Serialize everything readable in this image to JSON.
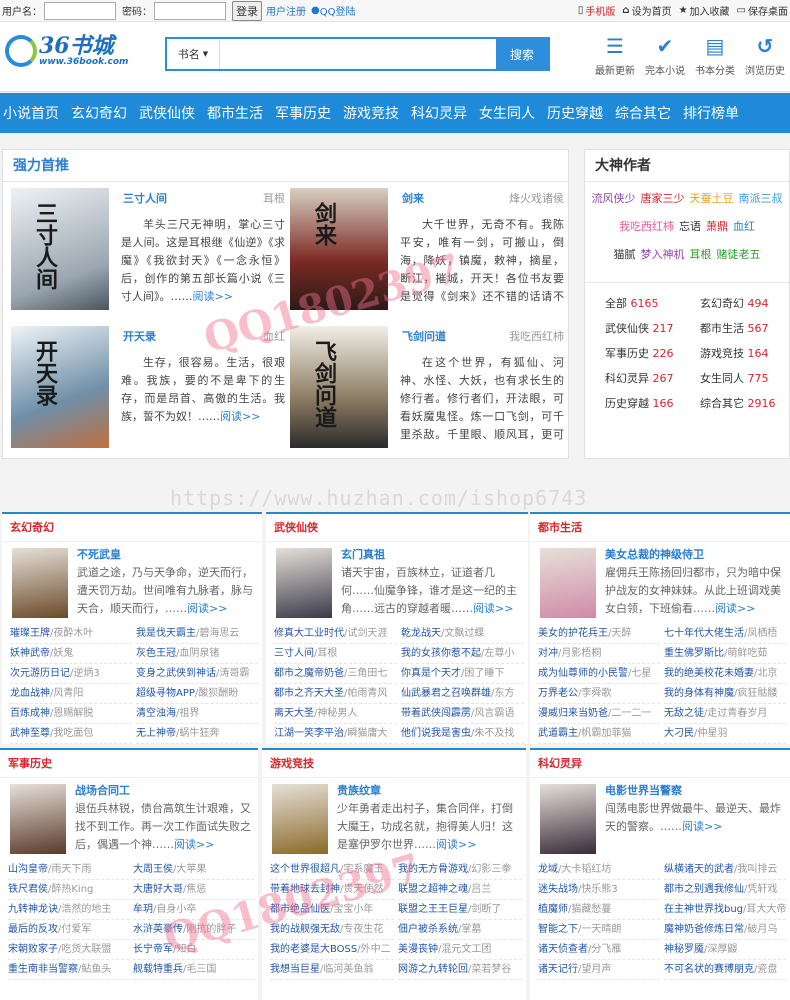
{
  "topbar": {
    "username_label": "用户名：",
    "password_label": "密码：",
    "login_btn": "登录",
    "register": "用户注册",
    "qq_login": "QQ登陆",
    "mobile": "手机版",
    "homepage": "设为首页",
    "favorite": "加入收藏",
    "save_desktop": "保存桌面"
  },
  "header": {
    "logo_name": "36书城",
    "logo_url": "www.36book.com",
    "search_select": "书名",
    "search_btn": "搜索",
    "icons": [
      {
        "label": "最新更新",
        "icon": "list-icon"
      },
      {
        "label": "完本小说",
        "icon": "check-circle-icon"
      },
      {
        "label": "书本分类",
        "icon": "book-icon"
      },
      {
        "label": "浏览历史",
        "icon": "history-icon"
      }
    ]
  },
  "nav": [
    "小说首页",
    "玄幻奇幻",
    "武侠仙侠",
    "都市生活",
    "军事历史",
    "游戏竞技",
    "科幻灵异",
    "女生同人",
    "历史穿越",
    "综合其它",
    "排行榜单"
  ],
  "featured": {
    "title": "强力首推",
    "books": [
      {
        "title": "三寸人间",
        "author": "耳根",
        "desc": "羊头三尺无神明，掌心三寸是人间。这是耳根继《仙逆》《求魔》《我欲封天》《一念永恒》后，创作的第五部长篇小说《三寸人间》。……",
        "more": "阅读>>"
      },
      {
        "title": "剑来",
        "author": "烽火戏诸侯",
        "desc": "大千世界，无奇不有。我陈平安，唯有一剑，可搬山，倒海，降妖，镇魔，敕神，摘星，断江，摧城，开天！各位书友要是觉得《剑来》还不错的话请不要……",
        "more": "阅读>>"
      },
      {
        "title": "开天录",
        "author": "血红",
        "desc": "生存，很容易。生活，很艰难。我族，要的不是卑下的生存，而是昂首、高傲的生活。我族，誓不为奴！……",
        "more": "阅读>>"
      },
      {
        "title": "飞剑问道",
        "author": "我吃西红柿",
        "desc": "在这个世界，有狐仙、河神、水怪、大妖，也有求长生的修行者。修行者们，开法眼，可看妖魔鬼怪。炼一口飞剑，可千里杀敌。千里眼、顺风耳，更可探查四……",
        "more": "阅读>>"
      }
    ]
  },
  "authors": {
    "title": "大神作者",
    "rows": [
      [
        "流风侠少",
        "唐家三少",
        "天蚕土豆",
        "南派三叔"
      ],
      [
        "我吃西红柿",
        "忘语",
        "萧鼎",
        "血红"
      ],
      [
        "猫腻",
        "梦入神机",
        "耳根",
        "赌徒老五"
      ]
    ],
    "colors": [
      [
        "#8e44ad",
        "#d9242b",
        "#e8a317",
        "#3a9ad9"
      ],
      [
        "#e95aa0",
        "#333333",
        "#d9242b",
        "#2a7fd2"
      ],
      [
        "#333333",
        "#8e44ad",
        "#2a9d2a",
        "#2a9d2a"
      ]
    ]
  },
  "categories": [
    {
      "name": "全部",
      "count": "6165"
    },
    {
      "name": "玄幻奇幻",
      "count": "494"
    },
    {
      "name": "武侠仙侠",
      "count": "217"
    },
    {
      "name": "都市生活",
      "count": "567"
    },
    {
      "name": "军事历史",
      "count": "226"
    },
    {
      "name": "游戏竞技",
      "count": "164"
    },
    {
      "name": "科幻灵异",
      "count": "267"
    },
    {
      "name": "女生同人",
      "count": "775"
    },
    {
      "name": "历史穿越",
      "count": "166"
    },
    {
      "name": "综合其它",
      "count": "2916"
    }
  ],
  "watermark": {
    "url": "https://www.huzhan.com/ishop6743",
    "qq": "QQ1802397"
  },
  "sections": [
    {
      "title": "玄幻奇幻",
      "book": {
        "title": "不死武皇",
        "desc": "武道之途，乃与天争命，逆天而行，遭天罚万劫。世间唯有九脉者，脉与天合，顺天而行，……",
        "more": "阅读>>"
      },
      "links": [
        [
          "璀璨王牌",
          "/夜酔木叶"
        ],
        [
          "我是伐天霸主",
          "/碧海思云"
        ],
        [
          "妖神武帝",
          "/妖鬼"
        ],
        [
          "灰色王冠",
          "/血阴泉锗"
        ],
        [
          "次元游历日记",
          "/逆炳3"
        ],
        [
          "变身之武侠到神话",
          "/涛哥霸"
        ],
        [
          "龙血战神",
          "/风青阳"
        ],
        [
          "超级寻物APP",
          "/酸狈酬盼"
        ],
        [
          "百炼成神",
          "/恩赐解脱"
        ],
        [
          "清空浊海",
          "/祖界"
        ],
        [
          "武神至尊",
          "/我吃面包"
        ],
        [
          "无上神帝",
          "/蜗牛狂奔"
        ]
      ]
    },
    {
      "title": "武侠仙侠",
      "book": {
        "title": "玄门真祖",
        "desc": "诸天宇宙，百族林立，证道者几何……仙魔争锋，谁才是这一纪的主角……远古的穿越者暖……",
        "more": "阅读>>"
      },
      "links": [
        [
          "修真大工业时代",
          "/试剑天涯"
        ],
        [
          "乾龙战天",
          "/文飘过蝶"
        ],
        [
          "三寸人间",
          "/耳根"
        ],
        [
          "我的女孩你惹不起",
          "/左尊小"
        ],
        [
          "都市之魔帝奶爸",
          "/三角田七"
        ],
        [
          "你真是个天才",
          "/困了睡下"
        ],
        [
          "都市之齐天大圣",
          "/帕雨青风"
        ],
        [
          "仙武暴君之召唤群雄",
          "/东方"
        ],
        [
          "离天大圣",
          "/神秘男人"
        ],
        [
          "带着武侠闯霹雳",
          "/风言霸语"
        ],
        [
          "江湖一笑李平治",
          "/瞬猫庸大"
        ],
        [
          "他们说我是害虫",
          "/朱不及找"
        ]
      ]
    },
    {
      "title": "都市生活",
      "book": {
        "title": "美女总裁的神级侍卫",
        "desc": "雇佣兵王陈扬回归都市，只为暗中保护战友的女神妹妹。从此上班调戏美女白领，下班偷看……",
        "more": "阅读>>"
      },
      "links": [
        [
          "美女的护花兵王",
          "/天醉"
        ],
        [
          "七十年代大佬生活",
          "/凤栖梧"
        ],
        [
          "对冲",
          "/月影梧桐"
        ],
        [
          "重生佛罗斯比",
          "/萌鲜吃茹"
        ],
        [
          "成为仙尊师的小民警",
          "/七星"
        ],
        [
          "我的绝美校花未婚妻",
          "/北京"
        ],
        [
          "万界老公",
          "/李舜歌"
        ],
        [
          "我的身体有神魔",
          "/疯狂骷髅"
        ],
        [
          "漫威归来当奶爸",
          "/二一二一"
        ],
        [
          "无敌之徒",
          "/走过青春岁月"
        ],
        [
          "武道霸主",
          "/帆霸加菲猫"
        ],
        [
          "大刁民",
          "/仲星羽"
        ]
      ]
    },
    {
      "title": "军事历史",
      "book": {
        "title": "战场合同工",
        "desc": "退伍兵林锐，债台高筑生计艰难，又找不到工作。再一次工作面试失败之后，偶遇一个神……",
        "more": "阅读>>"
      },
      "links": [
        [
          "山沟皇帝",
          "/雨天下雨"
        ],
        [
          "大周王侯",
          "/大苹果"
        ],
        [
          "铁尺君侯",
          "/醉热King"
        ],
        [
          "大唐好大哥",
          "/焦惩"
        ],
        [
          "九转神龙诀",
          "/浩然的地主"
        ],
        [
          "牟玥",
          "/自身小卒"
        ],
        [
          "最后的反攻",
          "/付爱军"
        ],
        [
          "水浒英豪传",
          "/刚抗的胖子"
        ],
        [
          "宋朝败家子",
          "/吃货大联盟"
        ],
        [
          "长宁帝军",
          "/知白"
        ],
        [
          "重生南非当警察",
          "/鲇鱼头"
        ],
        [
          "舰载特重兵",
          "/毛三国"
        ]
      ]
    },
    {
      "title": "游戏竞技",
      "book": {
        "title": "贵族纹章",
        "desc": "少年勇者走出村子，集合同伴，打倒大魔王，功成名就，抱得美人归！这是塞伊罗尔世界……",
        "more": "阅读>>"
      },
      "links": [
        [
          "这个世界很超凡",
          "/宅系魔王"
        ],
        [
          "我的无方骨游戏",
          "/幻影三拳"
        ],
        [
          "带着地球去封神",
          "/贵天使然"
        ],
        [
          "联盟之超神之魂",
          "/吕兰"
        ],
        [
          "都市绝品仙医",
          "/宝宝小年"
        ],
        [
          "联盟之王王巨星",
          "/剑断了"
        ],
        [
          "我的战舰强无敌",
          "/专夜生花"
        ],
        [
          "佃户被杀系统",
          "/掌墓"
        ],
        [
          "我的老婆是大BOSS",
          "/外中二"
        ],
        [
          "美漫丧钟",
          "/混元文工团"
        ],
        [
          "我想当巨星",
          "/临河美鱼翁"
        ],
        [
          "网游之九转轮回",
          "/菜若梦谷"
        ]
      ]
    },
    {
      "title": "科幻灵异",
      "book": {
        "title": "电影世界当警察",
        "desc": "闯荡电影世界做最牛、最逆天、最炸天的警察。……",
        "more": "阅读>>"
      },
      "links": [
        [
          "龙域",
          "/大卡韬红坊"
        ],
        [
          "纵横诸天的武者",
          "/我叫排云"
        ],
        [
          "迷失战场",
          "/快乐熊3"
        ],
        [
          "都市之别遇我修仙",
          "/凭轩戏"
        ],
        [
          "植魔师",
          "/猫藏愁蔓"
        ],
        [
          "在主神世界找bug",
          "/耳大大帝"
        ],
        [
          "智能之下",
          "/一天晴朗"
        ],
        [
          "魔神奶爸修炼日常",
          "/破月乌"
        ],
        [
          "诸天侦查者",
          "/分飞雁"
        ],
        [
          "神秘罗魇",
          "/深厚鼹"
        ],
        [
          "诸天记行",
          "/望月声"
        ],
        [
          "不可名状的赛博朋克",
          "/瓷盘"
        ]
      ]
    }
  ]
}
